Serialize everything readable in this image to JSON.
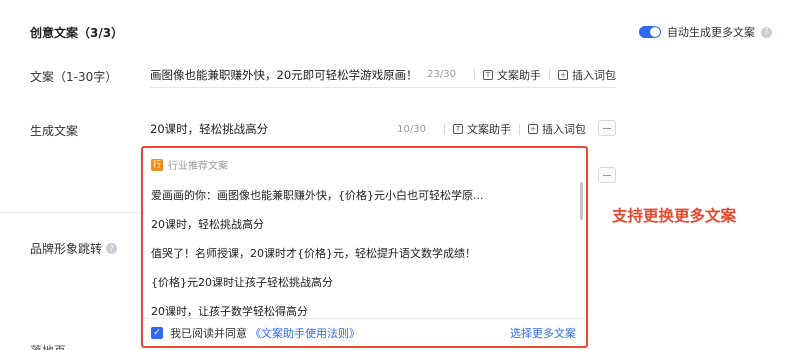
{
  "section_title": "创意文案（3/3）",
  "auto_toggle": {
    "label": "自动生成更多文案",
    "on": true
  },
  "copy_row": {
    "label": "文案（1-30字）",
    "value": "画图像也能兼职赚外快，20元即可轻松学游戏原画！",
    "count": "23/30",
    "assistant": "文案助手",
    "insert": "插入词包"
  },
  "gen_row": {
    "label": "生成文案",
    "value": "20课时，轻松挑战高分",
    "count": "10/30",
    "assistant": "文案助手",
    "insert": "插入词包"
  },
  "dropdown": {
    "header": "行业推荐文案",
    "badge": "行",
    "items": [
      "爱画画的你：画图像也能兼职赚外快，{价格}元小白也可轻松学原...",
      "20课时，轻松挑战高分",
      "值哭了！名师授课，20课时才{价格}元，轻松提升语文数学成绩！",
      "{价格}元20课时让孩子轻松挑战高分",
      "20课时，让孩子数学轻松得高分"
    ],
    "agree": "我已阅读并同意",
    "rules": "《文案助手使用法则》",
    "more": "选择更多文案"
  },
  "brand_label": "品牌形象跳转",
  "cut_label": "落地页",
  "annotation": "支持更换更多文案",
  "colors": {
    "accent": "#2f6bf0",
    "highlight": "#e84a2f",
    "badge": "#f28b1e"
  }
}
